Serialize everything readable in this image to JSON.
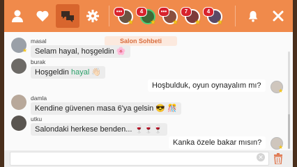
{
  "topbar": {
    "buttons": [
      {
        "name": "profile-icon"
      },
      {
        "name": "heart-icon"
      },
      {
        "name": "chat-bubbles-icon",
        "active": true
      },
      {
        "name": "settings-gear-icon"
      }
    ],
    "avatars": [
      {
        "badge": "•••",
        "color": "#6b5443"
      },
      {
        "badge": "4",
        "color": "#3f6a38"
      },
      {
        "badge": "•••",
        "color": "#8a4f3f"
      },
      {
        "badge": "7",
        "color": "#7e3a3a"
      },
      {
        "badge": "4",
        "color": "#5b4a66"
      }
    ]
  },
  "chat": {
    "room_label": "Salon Sohbeti",
    "messages": [
      {
        "user": "masal",
        "text": "Selam hayal, hoşgeldin",
        "emoji": "🌸"
      },
      {
        "user": "burak",
        "text_prefix": "Hoşgeldin",
        "highlight": "hayal",
        "emoji": "👋🏻"
      },
      {
        "outgoing": true,
        "text": "Hoşbulduk, oyun oynayalım mı?"
      },
      {
        "user": "damla",
        "text": "Kendine güvenen masa 6'ya gelsin",
        "emoji": "😎 🎊"
      },
      {
        "user": "utku",
        "text": "Salondaki herkese benden...",
        "emoji": "🍷🍷🍷"
      },
      {
        "outgoing": true,
        "text": "Kanka özele bakar mısın?"
      }
    ]
  },
  "input": {
    "value": ""
  },
  "colors": {
    "accent": "#f08a4b",
    "active": "#d8652d",
    "badge": "#d8222c"
  }
}
